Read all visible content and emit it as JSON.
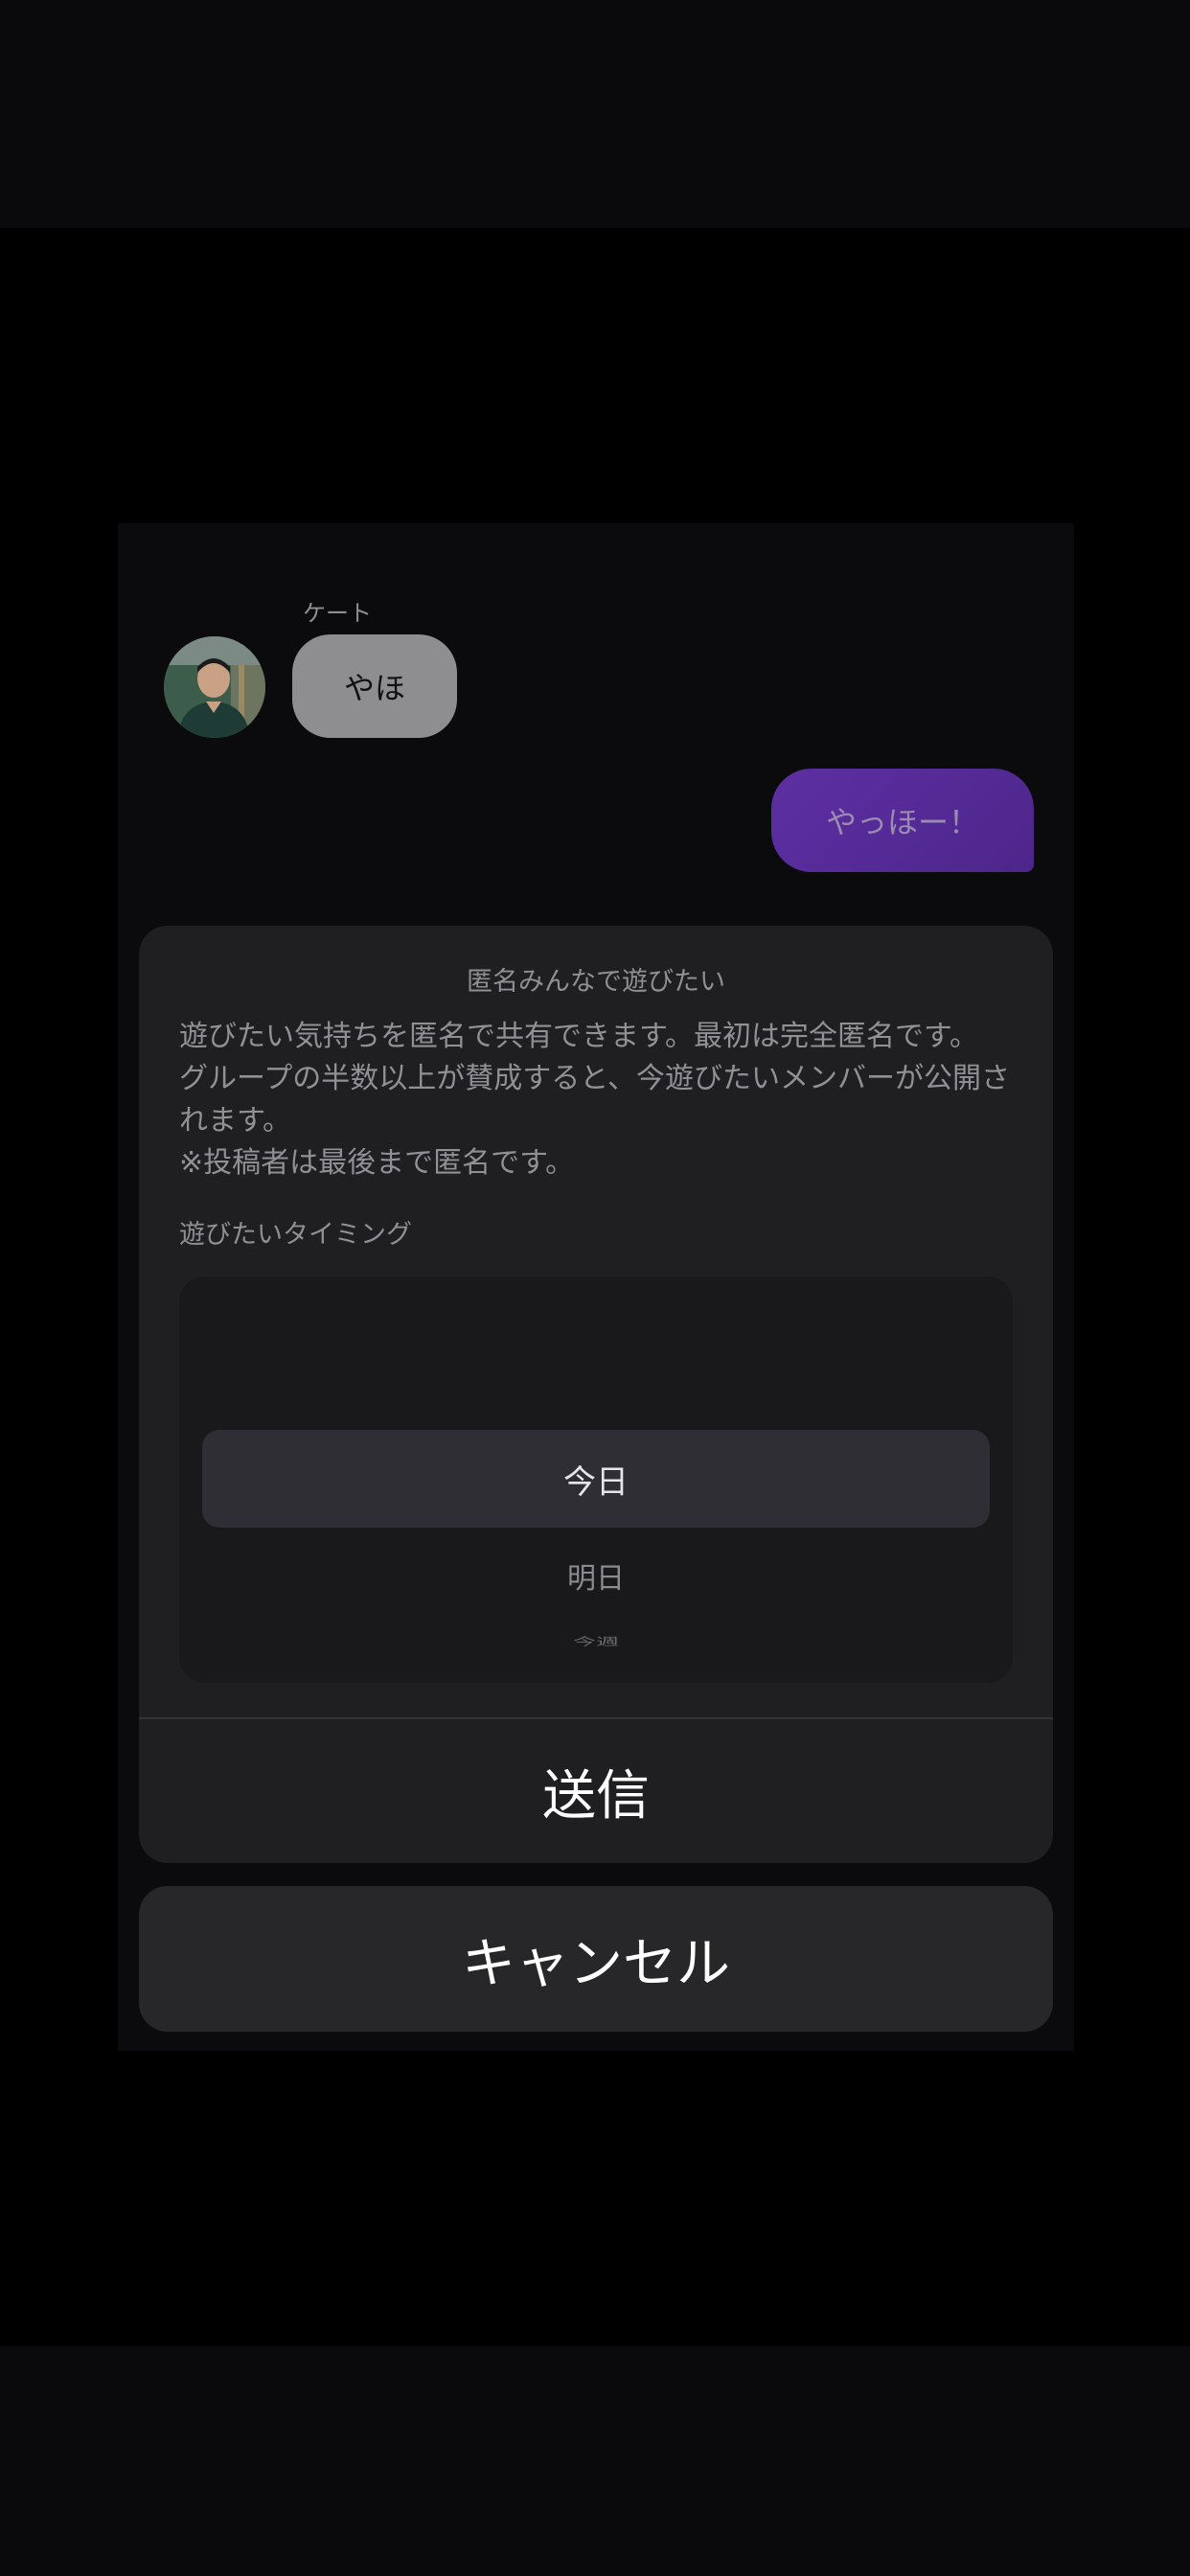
{
  "chat": {
    "incoming": {
      "sender": "ケート",
      "text": "やほ"
    },
    "outgoing": {
      "text": "やっほー！"
    }
  },
  "sheet": {
    "title": "匿名みんなで遊びたい",
    "description": [
      "遊びたい気持ちを匿名で共有できます。最初は完全匿名です。",
      "グループの半数以上が賛成すると、今遊びたいメンバーが公開さ",
      "れます。",
      "※投稿者は最後まで匿名です。"
    ],
    "timing_label": "遊びたいタイミング",
    "picker": {
      "selected": "今日",
      "options_below": [
        "明日",
        "今週"
      ]
    },
    "send_label": "送信"
  },
  "cancel_label": "キャンセル",
  "colors": {
    "accent": "#5d2fa3",
    "sheet_bg": "#1f1f21",
    "screen_bg": "#0b0a0c"
  }
}
